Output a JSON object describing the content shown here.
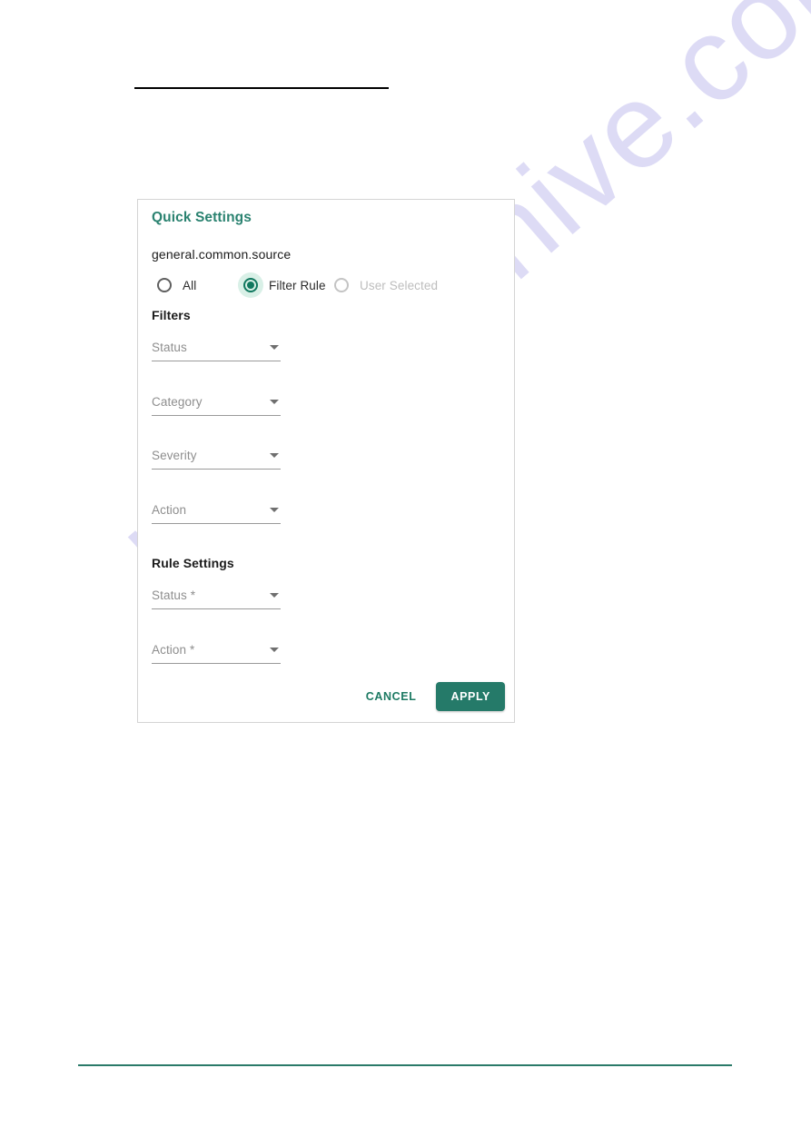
{
  "page": {
    "top_rule_color": "#000000",
    "bottom_rule_color": "#2a7a69",
    "watermark": "manualshive.com"
  },
  "dialog": {
    "title": "Quick Settings",
    "source_label": "general.common.source",
    "source_options": [
      {
        "label": "All",
        "selected": false,
        "disabled": false
      },
      {
        "label": "Filter Rule",
        "selected": true,
        "disabled": false
      },
      {
        "label": "User Selected",
        "selected": false,
        "disabled": true
      }
    ],
    "filters": {
      "heading": "Filters",
      "fields": [
        {
          "label": "Status",
          "value": ""
        },
        {
          "label": "Category",
          "value": ""
        },
        {
          "label": "Severity",
          "value": ""
        },
        {
          "label": "Action",
          "value": ""
        }
      ]
    },
    "rule_settings": {
      "heading": "Rule Settings",
      "fields": [
        {
          "label": "Status *",
          "value": ""
        },
        {
          "label": "Action *",
          "value": ""
        }
      ]
    },
    "footer": {
      "cancel_label": "CANCEL",
      "apply_label": "APPLY"
    },
    "colors": {
      "accent": "#257a69",
      "title": "#2a8270",
      "radio_selected": "#11785f",
      "disabled_text": "#bdbdbd"
    }
  }
}
